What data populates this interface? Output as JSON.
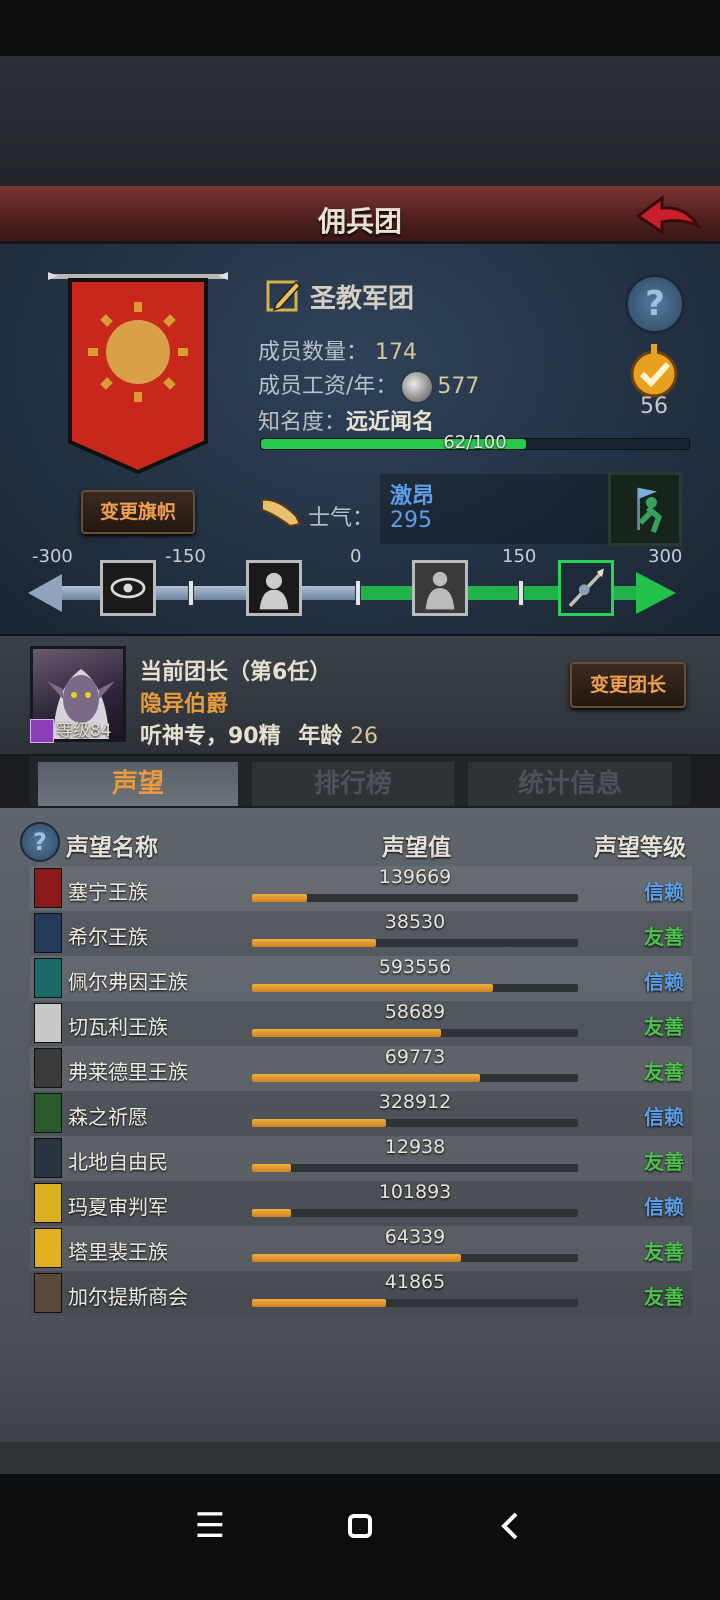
{
  "header": {
    "title": "佣兵团"
  },
  "team": {
    "name": "圣教军团",
    "members_label": "成员数量：",
    "members_value": "174",
    "wage_label": "成员工资/年：",
    "wage_value": "577",
    "fame_label": "知名度：",
    "fame_value": "远近闻名",
    "fame_progress_text": "62/100",
    "fame_progress": 0.62,
    "badge_value": "56",
    "change_flag_label": "变更旗帜"
  },
  "morale": {
    "label": "士气：",
    "state": "激昂",
    "value": "295",
    "scale_labels": [
      "-300",
      "-150",
      "0",
      "150",
      "300"
    ]
  },
  "leader": {
    "title": "当前团长（第6任）",
    "name": "隐异伯爵",
    "traits": "听神专，90精",
    "age_label": "年龄",
    "age_value": "26",
    "level_label": "等级84",
    "change_label": "变更团长"
  },
  "tabs": [
    {
      "label": "声望",
      "active": true
    },
    {
      "label": "排行榜",
      "active": false
    },
    {
      "label": "统计信息",
      "active": false
    }
  ],
  "table": {
    "col_name": "声望名称",
    "col_value": "声望值",
    "col_level": "声望等级",
    "rows": [
      {
        "name": "塞宁王族",
        "value": "139669",
        "progress": 0.17,
        "level": "信赖",
        "level_color": "#5c9fe6",
        "emblem": "#8a1a1a"
      },
      {
        "name": "希尔王族",
        "value": "38530",
        "progress": 0.38,
        "level": "友善",
        "level_color": "#4cc24c",
        "emblem": "#243a5a"
      },
      {
        "name": "佩尔弗因王族",
        "value": "593556",
        "progress": 0.74,
        "level": "信赖",
        "level_color": "#5c9fe6",
        "emblem": "#1a6a6a"
      },
      {
        "name": "切瓦利王族",
        "value": "58689",
        "progress": 0.58,
        "level": "友善",
        "level_color": "#4cc24c",
        "emblem": "#c8c8c8"
      },
      {
        "name": "弗莱德里王族",
        "value": "69773",
        "progress": 0.7,
        "level": "友善",
        "level_color": "#4cc24c",
        "emblem": "#3a3a3a"
      },
      {
        "name": "森之祈愿",
        "value": "328912",
        "progress": 0.41,
        "level": "信赖",
        "level_color": "#5c9fe6",
        "emblem": "#2a5a2a"
      },
      {
        "name": "北地自由民",
        "value": "12938",
        "progress": 0.12,
        "level": "友善",
        "level_color": "#4cc24c",
        "emblem": "#2a3440"
      },
      {
        "name": "玛夏审判军",
        "value": "101893",
        "progress": 0.12,
        "level": "信赖",
        "level_color": "#5c9fe6",
        "emblem": "#d8b020"
      },
      {
        "name": "塔里裴王族",
        "value": "64339",
        "progress": 0.64,
        "level": "友善",
        "level_color": "#4cc24c",
        "emblem": "#e0b020"
      },
      {
        "name": "加尔提斯商会",
        "value": "41865",
        "progress": 0.41,
        "level": "友善",
        "level_color": "#4cc24c",
        "emblem": "#5a4a3a"
      }
    ]
  },
  "icons": [
    "back-arrow-icon",
    "edit-icon",
    "help-icon",
    "coin-icon",
    "badge-check-icon",
    "horn-icon",
    "flag-runner-icon",
    "eye-icon",
    "despair-icon",
    "calm-icon",
    "spear-icon"
  ]
}
